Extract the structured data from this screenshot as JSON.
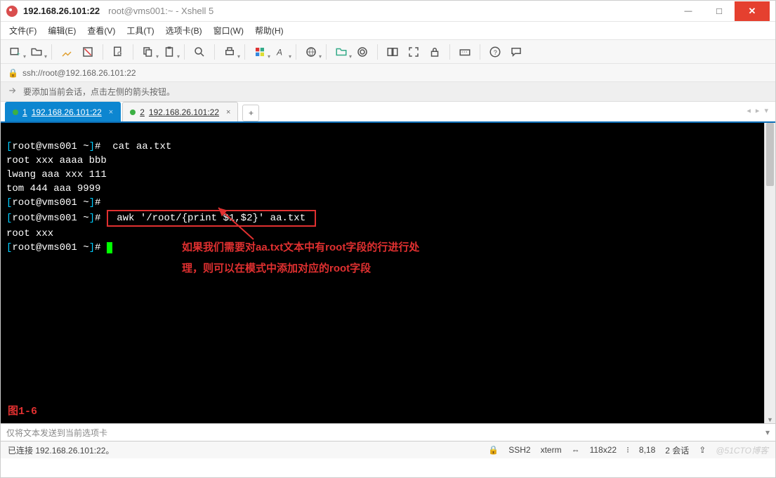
{
  "window": {
    "title_main": "192.168.26.101:22",
    "title_sub": "root@vms001:~ - Xshell 5"
  },
  "menu": {
    "file": "文件(F)",
    "edit": "编辑(E)",
    "view": "查看(V)",
    "tools": "工具(T)",
    "tab": "选项卡(B)",
    "window": "窗口(W)",
    "help": "帮助(H)"
  },
  "address": {
    "url": "ssh://root@192.168.26.101:22"
  },
  "hint": {
    "text": "要添加当前会话，点击左侧的箭头按钮。"
  },
  "tabs": [
    {
      "num": "1",
      "label": "192.168.26.101:22",
      "active": true
    },
    {
      "num": "2",
      "label": "192.168.26.101:22",
      "active": false
    }
  ],
  "tab_add": "+",
  "terminal": {
    "lines": [
      {
        "prompt": "[root@vms001 ~]#",
        "cmd": " cat aa.txt"
      },
      {
        "plain": "root xxx aaaa bbb"
      },
      {
        "plain": "lwang aaa xxx 111"
      },
      {
        "plain": "tom 444 aaa 9999"
      },
      {
        "prompt": "[root@vms001 ~]#",
        "cmd": ""
      },
      {
        "prompt": "[root@vms001 ~]#",
        "boxed": " awk '/root/{print $1,$2}' aa.txt "
      },
      {
        "plain": "root xxx"
      },
      {
        "prompt": "[root@vms001 ~]#",
        "cursor": true
      }
    ],
    "annotation1": "如果我们需要对aa.txt文本中有root字段的行进行处",
    "annotation2": "理，则可以在模式中添加对应的root字段",
    "figure_label": "图1-6"
  },
  "inputbar": {
    "placeholder": "仅将文本发送到当前选项卡"
  },
  "status": {
    "connected": "已连接  192.168.26.101:22。",
    "proto": "SSH2",
    "term": "xterm",
    "size": "118x22",
    "pos": "8,18",
    "sessions": "2 会话",
    "watermark": "@51CTO博客"
  },
  "icons": {
    "lock": "🔒",
    "size_icon": "⇔",
    "pos_icon": "⁝",
    "caps": "⇪"
  }
}
